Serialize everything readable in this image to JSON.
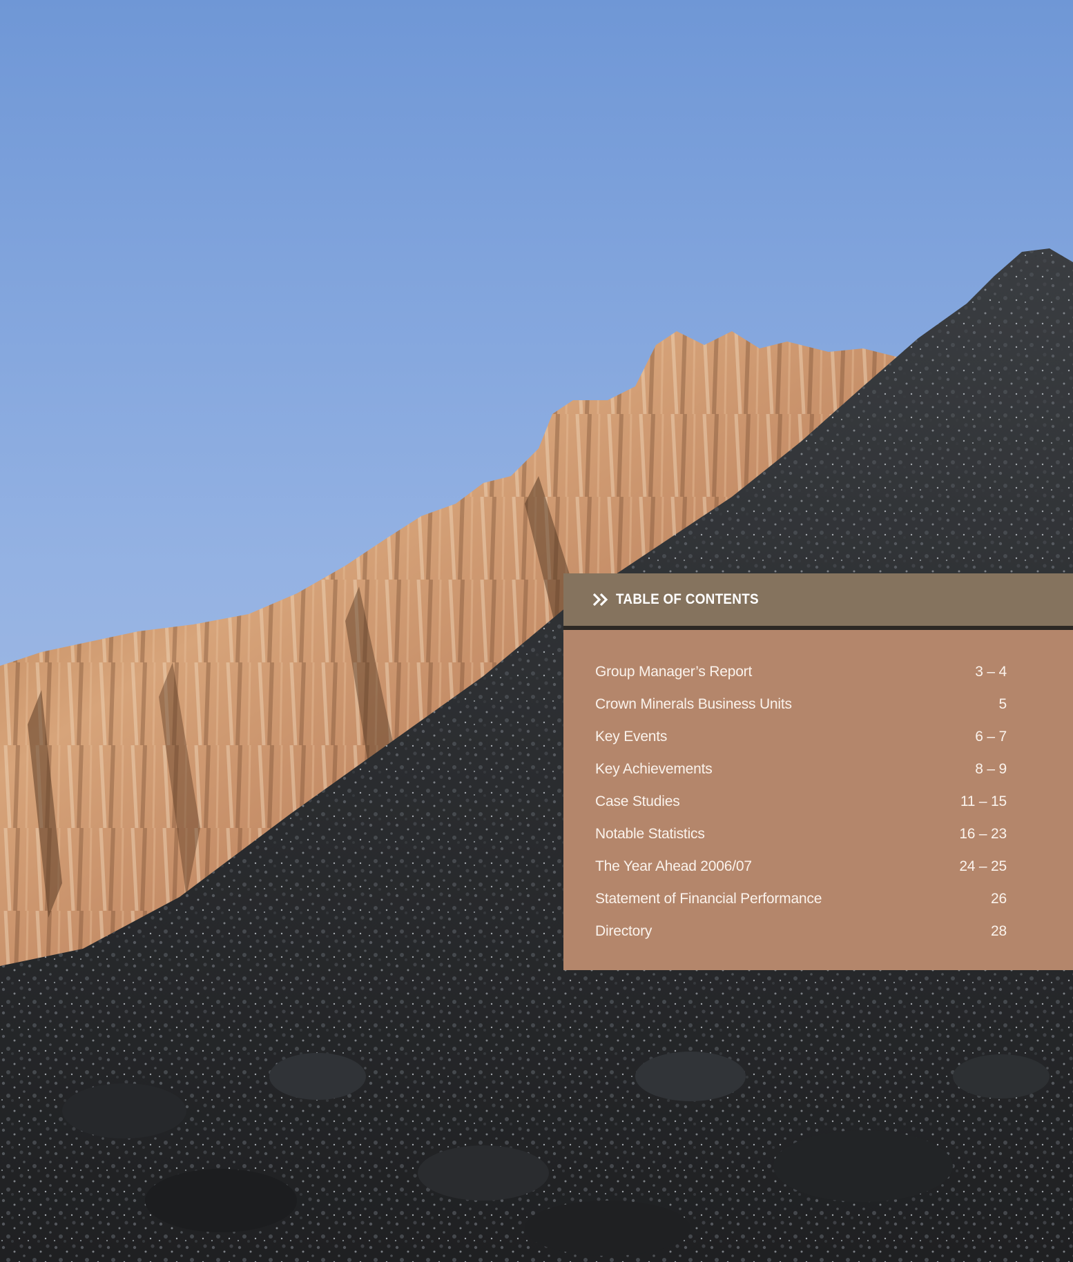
{
  "toc": {
    "heading": "TABLE OF CONTENTS",
    "entries": [
      {
        "label": "Group Manager’s Report",
        "pages": "3 – 4"
      },
      {
        "label": "Crown Minerals Business Units",
        "pages": "5"
      },
      {
        "label": "Key Events",
        "pages": "6 – 7"
      },
      {
        "label": "Key Achievements",
        "pages": "8 – 9"
      },
      {
        "label": "Case Studies",
        "pages": "11 – 15"
      },
      {
        "label": "Notable Statistics",
        "pages": "16 – 23"
      },
      {
        "label": "The Year Ahead 2006/07",
        "pages": "24 – 25"
      },
      {
        "label": "Statement of Financial Performance",
        "pages": "26"
      },
      {
        "label": "Directory",
        "pages": "28"
      }
    ]
  },
  "colors": {
    "header_band": "#85735e",
    "body_panel": "#b4866b",
    "sky": "#8fb0e0",
    "rock_face": "#c98a5a",
    "coal": "#2a2b2d"
  },
  "icons": {
    "heading_marker": "double-chevron-right-icon"
  }
}
